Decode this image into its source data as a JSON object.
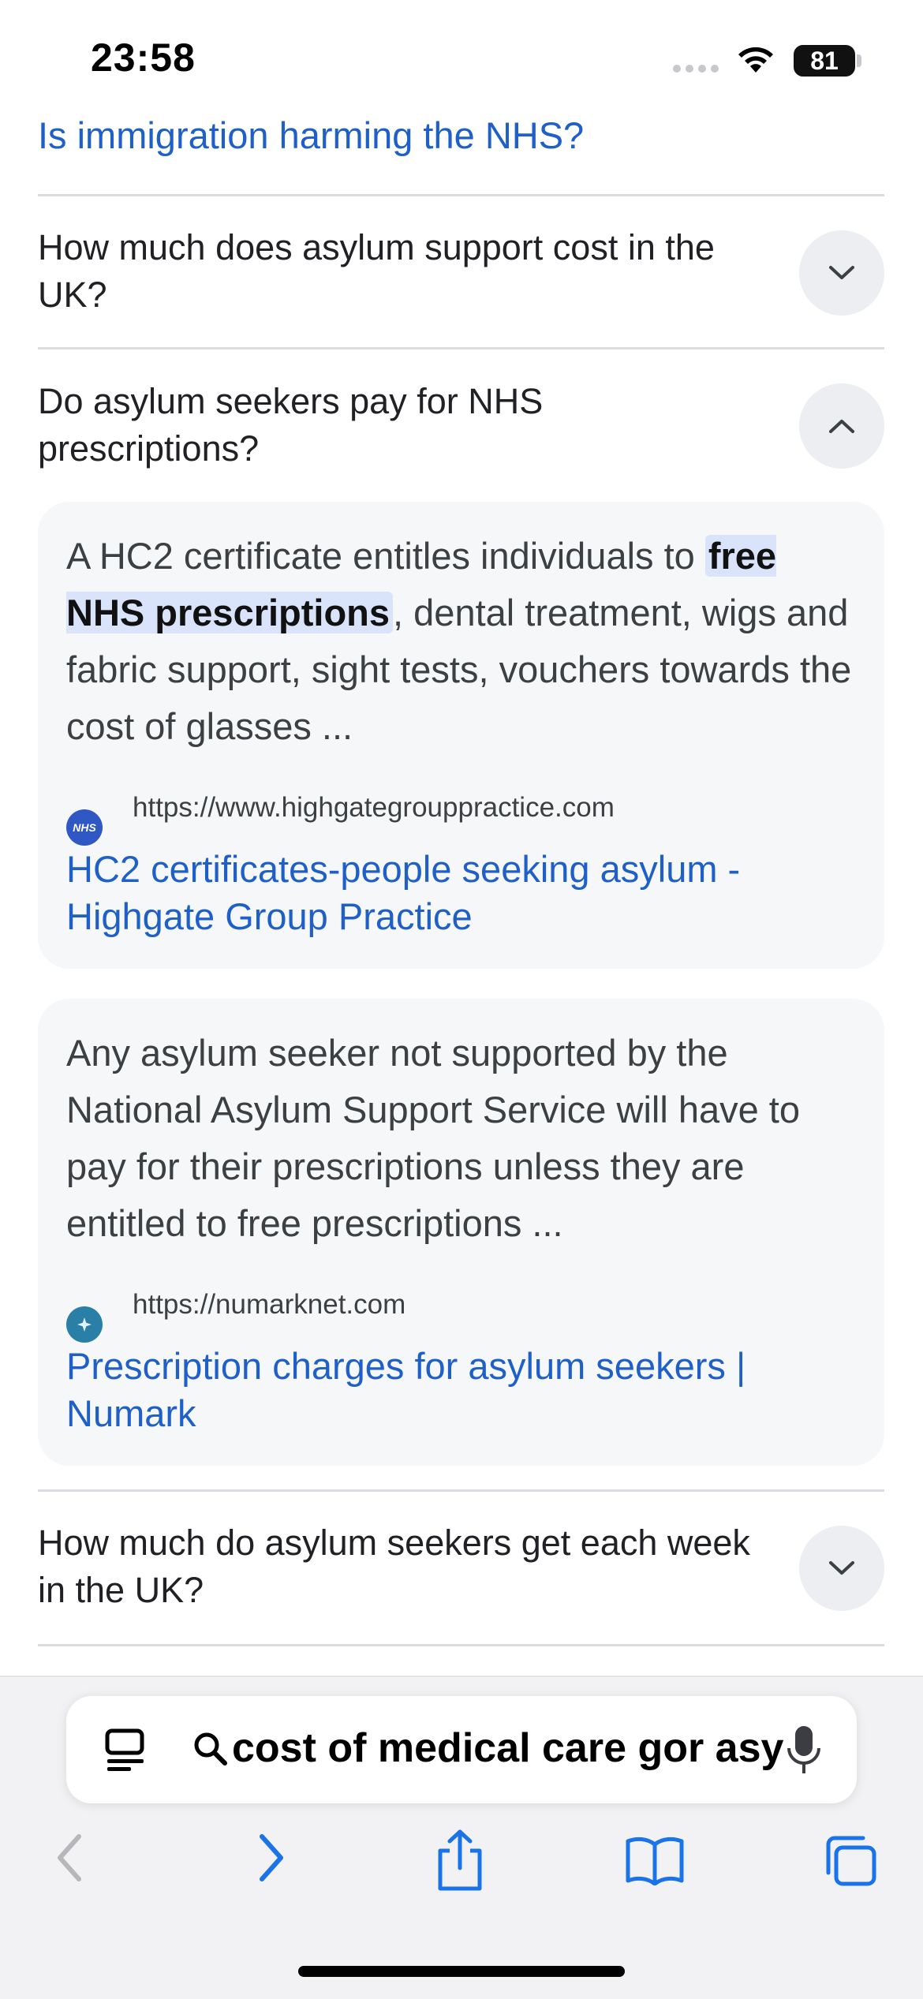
{
  "status_bar": {
    "time": "23:58",
    "battery": "81"
  },
  "top_link": "Is immigration harming the NHS?",
  "questions": [
    {
      "text": "How much does asylum support cost in the UK?"
    },
    {
      "text": "Do asylum seekers pay for NHS prescriptions?"
    },
    {
      "text": "How much do asylum seekers get each week in the UK?"
    }
  ],
  "answers": [
    {
      "snippet_before": "A HC2 certificate entitles individuals to ",
      "snippet_highlight": "free NHS prescriptions",
      "snippet_after": ", dental treatment, wigs and fabric support, sight tests, vouchers towards the cost of glasses ...",
      "favicon_text": "NHS",
      "url": "https://www.highgategrouppractice.com",
      "title": "HC2 certificates-people seeking asylum - Highgate Group Practice"
    },
    {
      "snippet": "Any asylum seeker not supported by the National Asylum Support Service will have to pay for their prescriptions unless they are entitled to free prescriptions ...",
      "url": "https://numarknet.com",
      "title": "Prescription charges for asylum seekers | Numark"
    }
  ],
  "address_bar": {
    "query": "cost of medical care gor asylum seekers uk"
  },
  "colors": {
    "link": "#1f5fc8",
    "highlight": "#d9e4fb",
    "accent": "#1a73e8"
  }
}
